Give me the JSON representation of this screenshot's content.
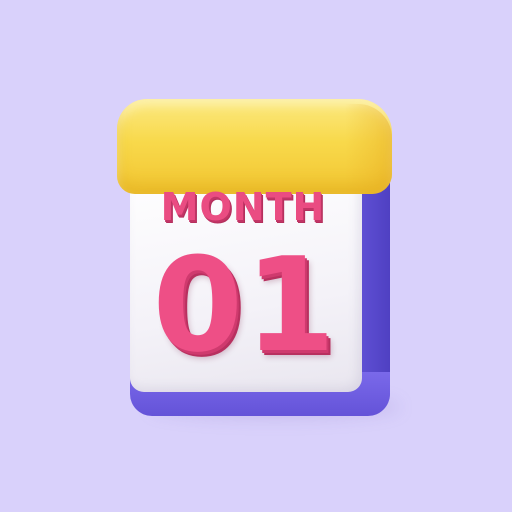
{
  "calendar": {
    "month_label": "MONTH",
    "day_number": "01"
  },
  "colors": {
    "background": "#D9D1FB",
    "binding": "#F8D94B",
    "body": "#6A5BE0",
    "page": "#FFFFFF",
    "text": "#EA4C82"
  }
}
